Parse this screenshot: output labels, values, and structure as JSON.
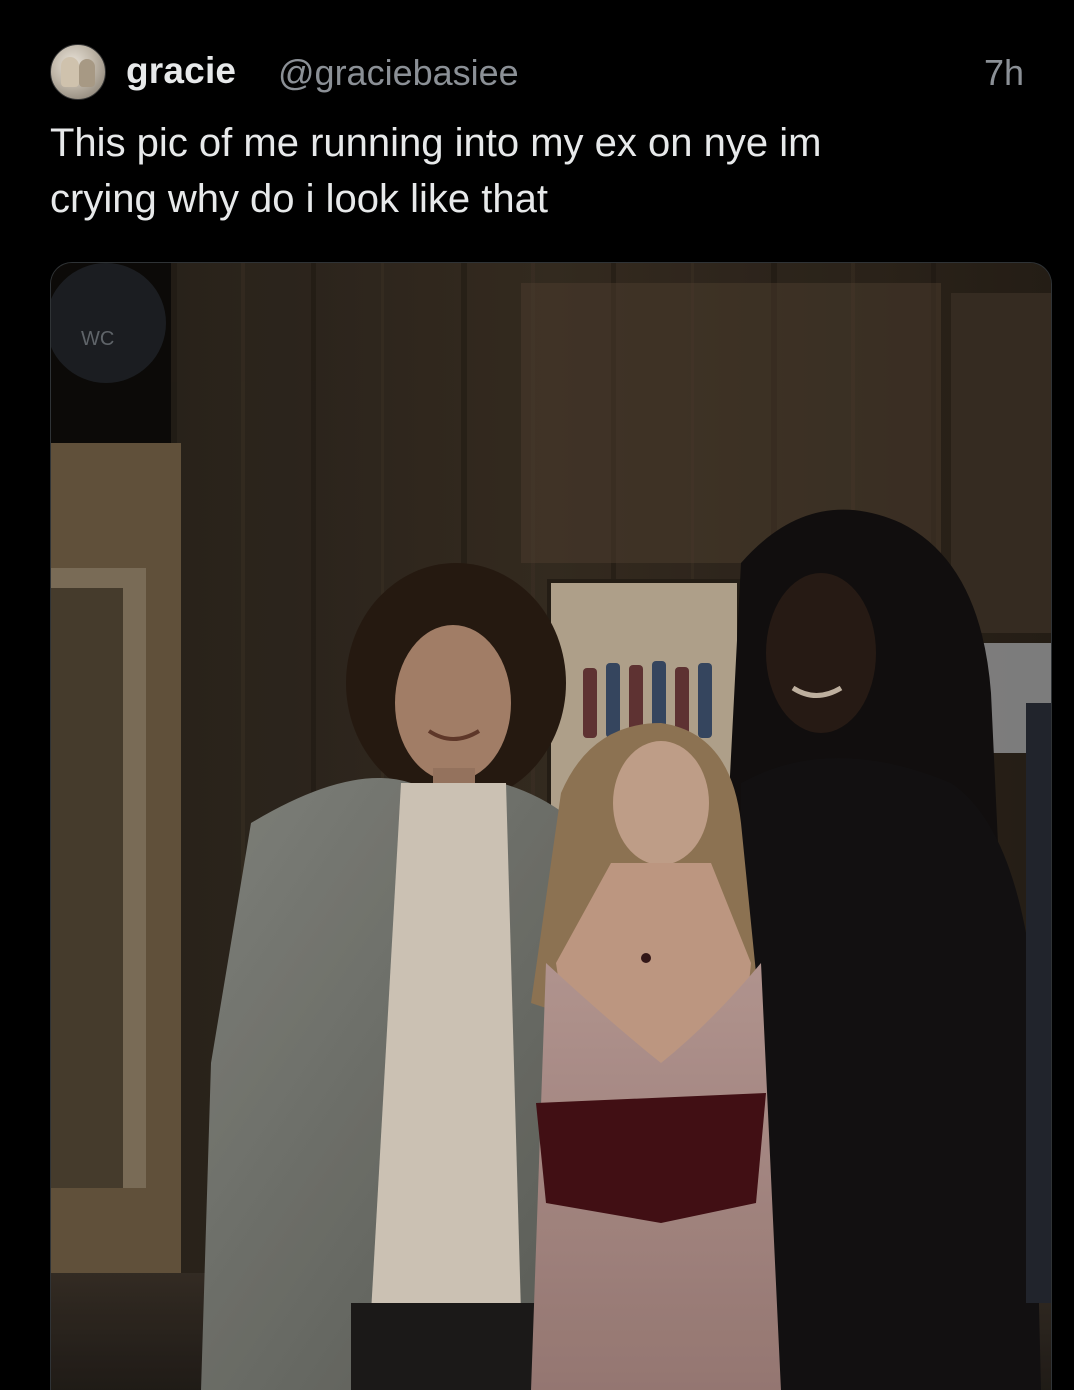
{
  "tweet": {
    "display_name": "gracie",
    "handle": "@graciebasiee",
    "timestamp": "7h",
    "text": "This pic of me running into my ex on nye im\ncrying why do i look like that",
    "avatar_icon": "profile-photo-avatar",
    "media": {
      "kind": "photo",
      "sign_text": "WC"
    }
  },
  "colors": {
    "background": "#000000",
    "text_primary": "#e7e9ea",
    "text_secondary": "#8b9096",
    "media_border": "#2f3336"
  }
}
